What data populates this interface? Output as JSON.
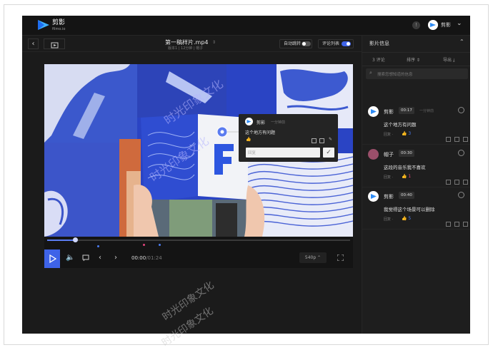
{
  "brand": {
    "name": "剪影",
    "sub": "filmo.io"
  },
  "header": {
    "user_name": "剪影",
    "info_icon": "info-icon",
    "chevron_icon": "chevron-down-icon"
  },
  "file": {
    "name": "第一稿样片.mp4",
    "meta": "版本1 | 12分钟 | 帽子"
  },
  "toggles": {
    "autoplay": {
      "label": "自动跳转",
      "on": false
    },
    "comment_list": {
      "label": "评论列表",
      "on": true
    }
  },
  "popup": {
    "author": "剪影",
    "ago": "一分钟前",
    "text": "这个地方有问题",
    "reply_placeholder": "回复"
  },
  "player": {
    "current": "00:00",
    "total": "/01:24",
    "quality": "540p ⌃",
    "progress": 0.09
  },
  "sidebar": {
    "title": "影片信息",
    "comment_count": "3 评论",
    "sort_label": "排序 ⇕",
    "export_label": "导出 ⤓",
    "search_placeholder": "搜索您想知道的信息",
    "comments": [
      {
        "author": "剪影",
        "time": "00:17",
        "ago": "一分钟前",
        "text": "这个地方有问题",
        "reply": "回复 ·",
        "likes": "3",
        "like_color": "#4a7cf0",
        "avatar_color": "#ffffff"
      },
      {
        "author": "帽子",
        "time": "00:30",
        "ago": "",
        "text": "这段的音乐我不喜欢",
        "reply": "回复 ·",
        "likes": "1",
        "like_color": "#e0457b",
        "avatar_color": "#9a4f6a"
      },
      {
        "author": "剪影",
        "time": "00:40",
        "ago": "",
        "text": "我觉得这个场景可以删除",
        "reply": "回复 ·",
        "likes": "5",
        "like_color": "#4a7cf0",
        "avatar_color": "#ffffff"
      }
    ]
  },
  "watermark": {
    "text": "时光印象文化"
  },
  "colors": {
    "accent": "#3e63e8",
    "bg": "#1b1b1b",
    "sidebar": "#1e1e1e"
  }
}
